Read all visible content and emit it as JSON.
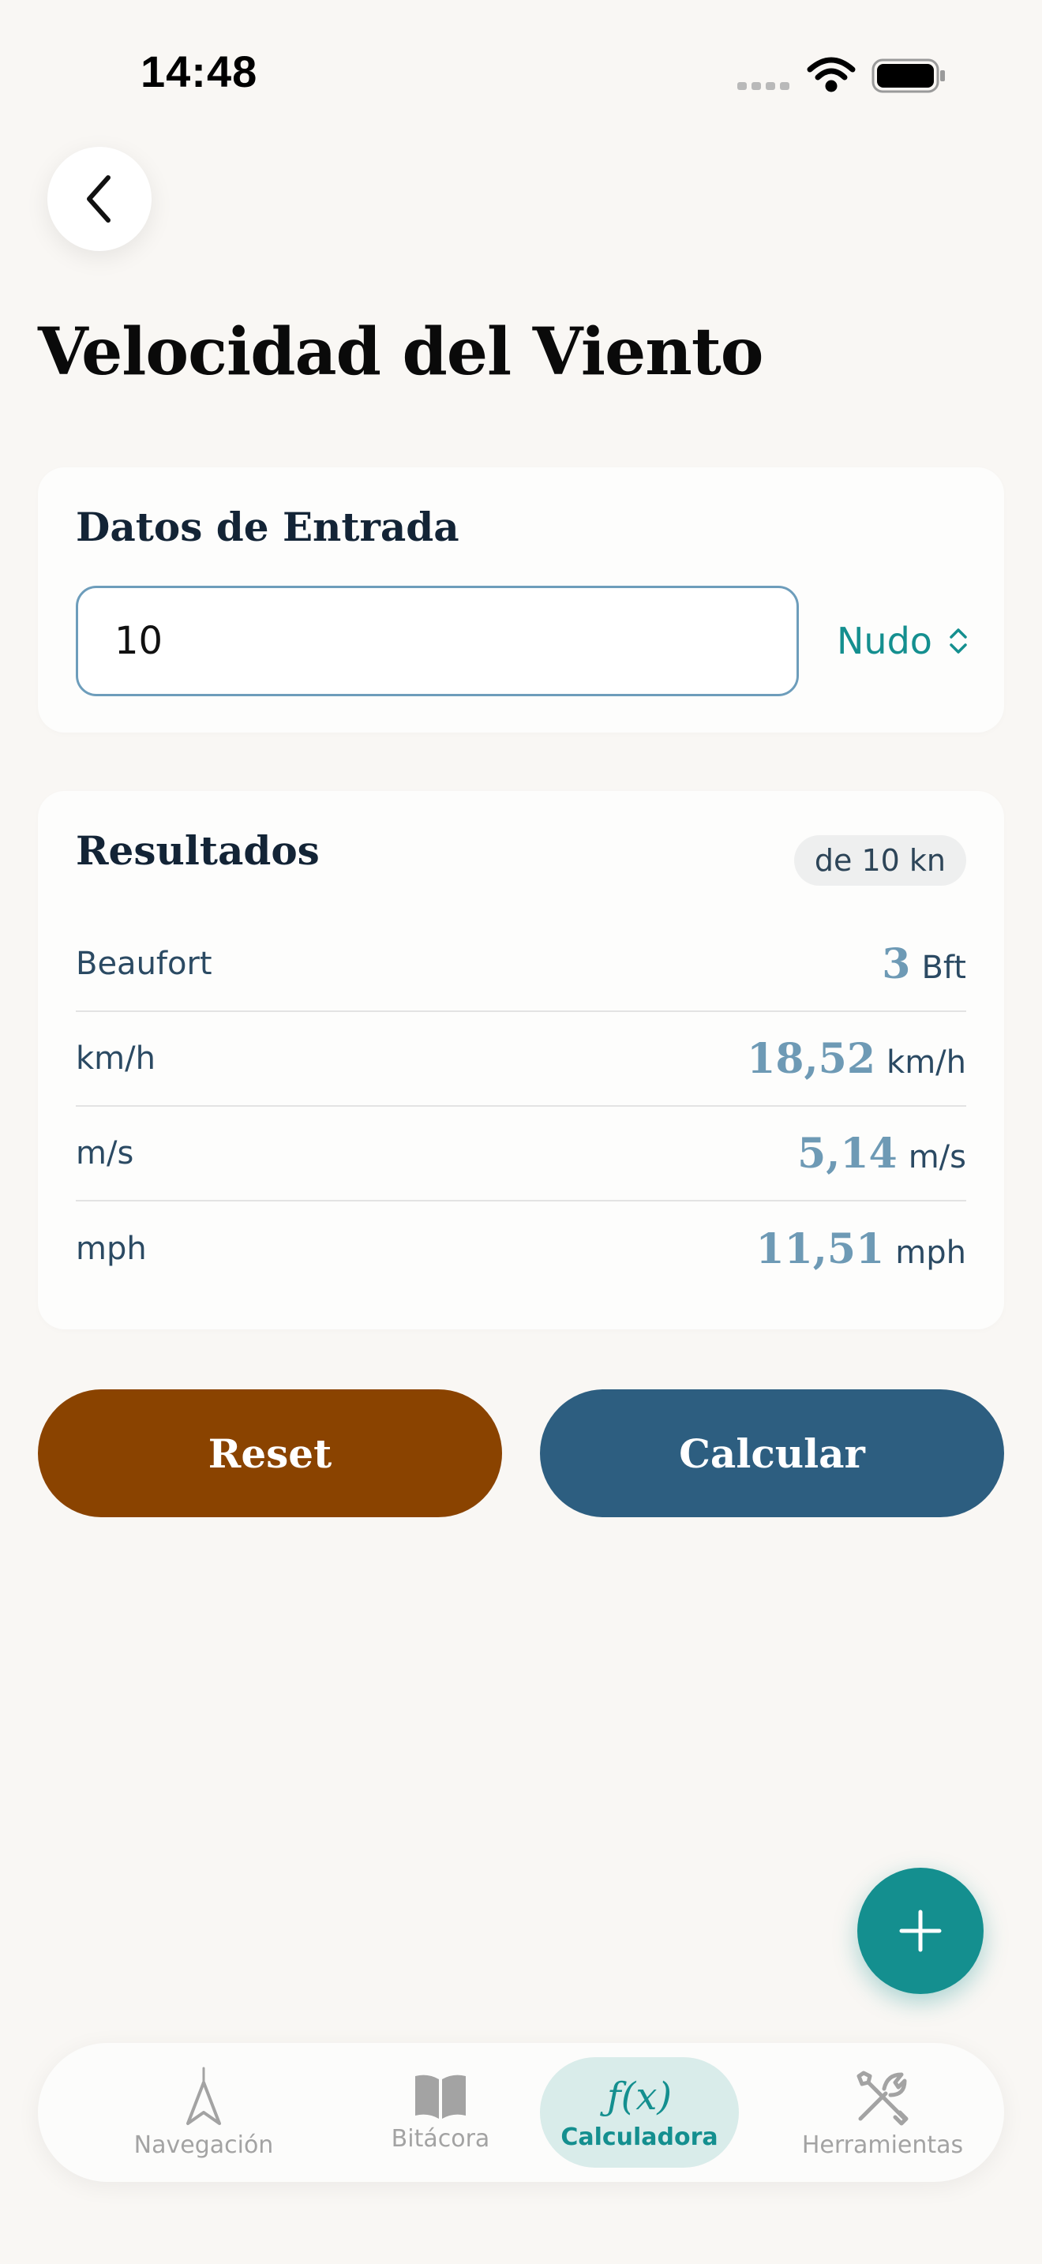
{
  "status_bar": {
    "time": "14:48"
  },
  "header": {
    "back_icon": "chevron-left-icon",
    "title": "Velocidad del Viento"
  },
  "input_card": {
    "heading": "Datos de Entrada",
    "value": "10",
    "unit": "Nudo"
  },
  "results_card": {
    "heading": "Resultados",
    "badge": "de 10 kn",
    "rows": [
      {
        "label": "Beaufort",
        "value": "3",
        "unit": "Bft"
      },
      {
        "label": "km/h",
        "value": "18,52",
        "unit": "km/h"
      },
      {
        "label": "m/s",
        "value": "5,14",
        "unit": "m/s"
      },
      {
        "label": "mph",
        "value": "11,51",
        "unit": "mph"
      }
    ]
  },
  "actions": {
    "reset_label": "Reset",
    "calculate_label": "Calcular"
  },
  "fab": {
    "icon": "plus-icon"
  },
  "tabbar": {
    "items": [
      {
        "label": "Navegación",
        "icon": "compass-arrow-icon",
        "active": false
      },
      {
        "label": "Bitácora",
        "icon": "book-icon",
        "active": false
      },
      {
        "label": "Calculadora",
        "icon": "function-icon",
        "glyph": "ƒ(x)",
        "active": true
      },
      {
        "label": "Herramientas",
        "icon": "tools-icon",
        "active": false
      }
    ]
  },
  "colors": {
    "accent": "#148f8f",
    "reset": "#8a4300",
    "calculate": "#2d5e80",
    "result_value": "#6e9ab5",
    "background": "#f9f7f4"
  }
}
